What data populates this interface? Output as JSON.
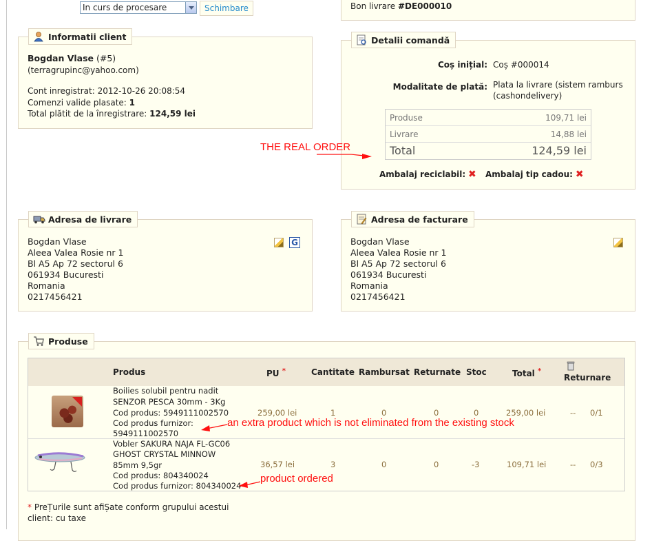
{
  "status": {
    "select_value": "In curs de procesare",
    "change_label": "Schimbare"
  },
  "voucher": {
    "label": "Bon livrare",
    "number": "#DE000010"
  },
  "client": {
    "legend": "Informatii client",
    "name": "Bogdan Vlase",
    "id": "(#5)",
    "email": "(terragrupinc@yahoo.com)",
    "registered": "Cont inregistrat: 2012-10-26 20:08:54",
    "orders_label": "Comenzi valide plasate:",
    "orders_value": "1",
    "total_label": "Total plătit de la înregistrare:",
    "total_value": "124,59 lei"
  },
  "order": {
    "legend": "Detalii comandă",
    "cart_label": "Coș inițial:",
    "cart_value": "Coș #000014",
    "payment_label": "Modalitate de plată:",
    "payment_line1": "Plata la livrare (sistem ramburs",
    "payment_line2": "(cashondelivery)",
    "products_label": "Produse",
    "products_value": "109,71 lei",
    "shipping_label": "Livrare",
    "shipping_value": "14,88 lei",
    "total_label": "Total",
    "total_value": "124,59 lei",
    "recycle_label": "Ambalaj reciclabil:",
    "gift_label": "Ambalaj tip cadou:"
  },
  "shipping_address": {
    "legend": "Adresa de livrare",
    "lines": [
      "Bogdan Vlase",
      "Aleea Valea Rosie nr 1",
      "Bl A5 Ap 72 sectorul 6",
      "061934 Bucuresti",
      "Romania",
      "0217456421"
    ]
  },
  "billing_address": {
    "legend": "Adresa de facturare",
    "lines": [
      "Bogdan Vlase",
      "Aleea Valea Rosie nr 1",
      "Bl A5 Ap 72 sectorul 6",
      "061934 Bucuresti",
      "Romania",
      "0217456421"
    ]
  },
  "products": {
    "legend": "Produse",
    "headers": {
      "product": "Produs",
      "unit_price": "PU",
      "asterisk": "*",
      "quantity": "Cantitate",
      "refunded": "Rambursat",
      "returned": "Returnate",
      "stock": "Stoc",
      "total": "Total",
      "return": "Returnare"
    },
    "rows": [
      {
        "name_lines": [
          "Boilies solubil pentru nadit",
          "SENZOR PESCA 30mm - 3Kg",
          "Cod produs: 5949111002570",
          "Cod produs furnizor:",
          "5949111002570"
        ],
        "unit_price": "259,00 lei",
        "quantity": "1",
        "refunded": "0",
        "returned": "0",
        "stock": "0",
        "total": "259,00 lei",
        "dash": "--",
        "return": "0/1"
      },
      {
        "name_lines": [
          "Vobler SAKURA NAJA FL-GC06",
          "GHOST CRYSTAL MINNOW",
          "85mm 9,5gr",
          "Cod produs: 804340024",
          "Cod produs furnizor: 804340024"
        ],
        "unit_price": "36,57 lei",
        "quantity": "3",
        "refunded": "0",
        "returned": "0",
        "stock": "-3",
        "total": "109,71 lei",
        "dash": "--",
        "return": "0/3"
      }
    ],
    "footnote_star": "*",
    "footnote_line1": "PreȚurile sunt afiȘate conform grupului acestui",
    "footnote_line2": "client: cu taxe"
  },
  "annotations": {
    "real_order": "THE REAL ORDER",
    "extra_product": "an extra product which is not eliminated from the existing stock",
    "product_ordered": "product ordered"
  }
}
